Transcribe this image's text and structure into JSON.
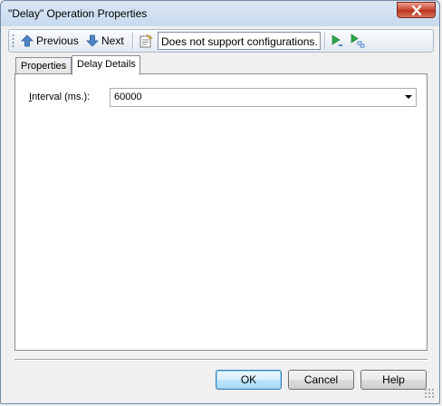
{
  "window": {
    "title": "\"Delay\" Operation Properties"
  },
  "toolbar": {
    "previous_label": "Previous",
    "next_label": "Next",
    "config_text": "Does not support configurations."
  },
  "tabs": [
    {
      "label": "Properties",
      "active": false
    },
    {
      "label": "Delay Details",
      "active": true
    }
  ],
  "details": {
    "interval_label_accel": "I",
    "interval_label_rest": "nterval (ms.):",
    "interval_value": "60000"
  },
  "buttons": {
    "ok": "OK",
    "cancel": "Cancel",
    "help": "Help"
  },
  "colors": {
    "close_button": "#c8452e",
    "toolbar_border": "#a9b8ca",
    "default_button_border": "#3c7fb1"
  },
  "icons": {
    "previous": "up-arrow-icon",
    "next": "down-arrow-icon",
    "properties": "properties-sheet-icon",
    "run": "play-icon",
    "run_step": "play-step-icon",
    "close": "close-icon"
  }
}
